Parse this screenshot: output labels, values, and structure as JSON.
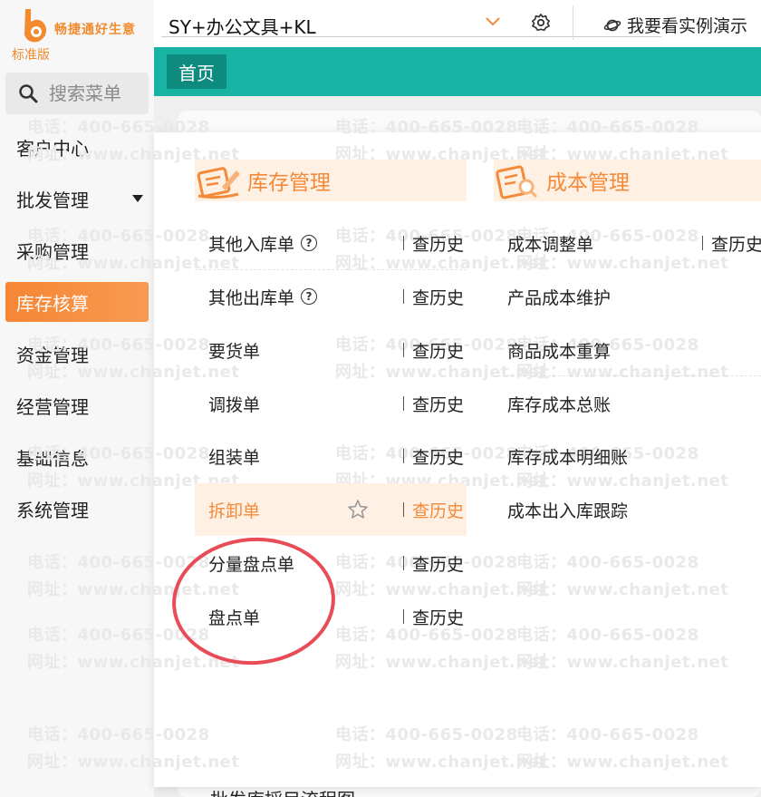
{
  "app": {
    "logo_text": "畅捷通好生意",
    "edition": "标准版"
  },
  "search": {
    "placeholder": "搜索菜单"
  },
  "sidebar": {
    "items": [
      {
        "label": "客户中心"
      },
      {
        "label": "批发管理",
        "has_caret": true
      },
      {
        "label": "采购管理"
      },
      {
        "label": "库存核算",
        "active": true
      },
      {
        "label": "资金管理"
      },
      {
        "label": "经营管理"
      },
      {
        "label": "基础信息"
      },
      {
        "label": "系统管理"
      }
    ]
  },
  "topbar": {
    "company": "SY+办公文具+KL",
    "demo_link": "我要看实例演示"
  },
  "tabs": {
    "home": "首页"
  },
  "content": {
    "under_text": "批发库採目流程图"
  },
  "watermark": {
    "phone": "电话：400-665-0028",
    "site": "网址：www.chanjet.net"
  },
  "panel": {
    "inventory": {
      "title": "库存管理",
      "entries": [
        {
          "label": "其他入库单",
          "help": true,
          "history": "查历史"
        },
        {
          "label": "其他出库单",
          "help": true,
          "history": "查历史"
        },
        {
          "label": "要货单",
          "history": "查历史"
        },
        {
          "label": "调拨单",
          "history": "查历史"
        },
        {
          "label": "组装单",
          "history": "查历史"
        },
        {
          "label": "拆卸单",
          "history": "查历史",
          "highlighted": true,
          "star": true
        },
        {
          "label": "分量盘点单",
          "history": "查历史"
        },
        {
          "label": "盘点单",
          "history": "查历史"
        }
      ]
    },
    "cost": {
      "title": "成本管理",
      "entries": [
        {
          "label": "成本调整单",
          "history": "查历史"
        },
        {
          "label": "产品成本维护"
        },
        {
          "label": "商品成本重算"
        },
        {
          "label": "库存成本总账"
        },
        {
          "label": "库存成本明细账"
        },
        {
          "label": "成本出入库跟踪"
        }
      ]
    }
  },
  "colors": {
    "accent": "#f38a3a",
    "teal": "#19b3a3",
    "annotation_circle": "#e84d57"
  }
}
